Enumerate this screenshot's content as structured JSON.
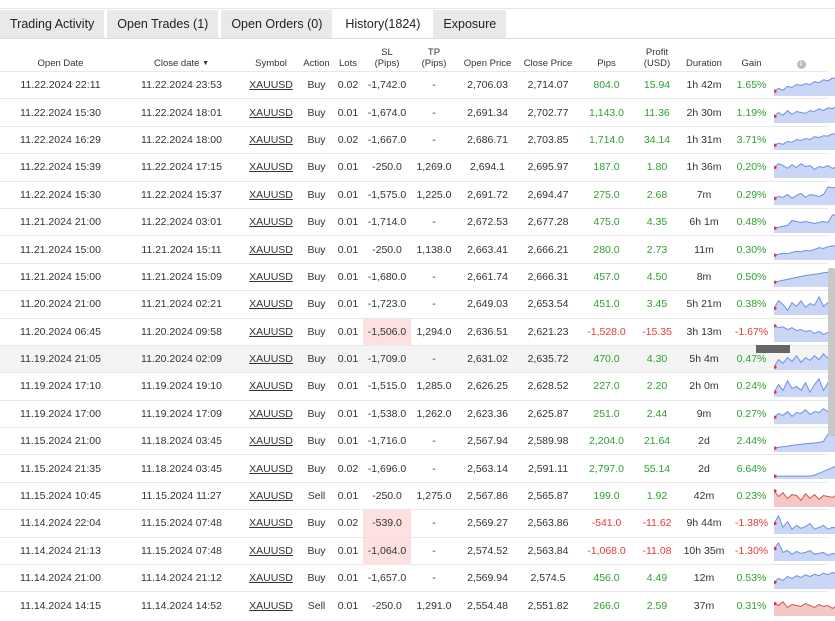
{
  "tabs": [
    {
      "label": "Trading Activity"
    },
    {
      "label": "Open Trades",
      "count": "(1)"
    },
    {
      "label": "Open Orders",
      "count": "(0)"
    },
    {
      "label": "History",
      "count": "(1824)"
    },
    {
      "label": "Exposure"
    }
  ],
  "columns": {
    "open_date": "Open Date",
    "close_date": "Close date",
    "symbol": "Symbol",
    "action": "Action",
    "lots": "Lots",
    "sl": "SL",
    "sl_unit": "(Pips)",
    "tp": "TP",
    "tp_unit": "(Pips)",
    "open_price": "Open Price",
    "close_price": "Close Price",
    "pips": "Pips",
    "profit": "Profit",
    "profit_unit": "(USD)",
    "duration": "Duration",
    "gain": "Gain",
    "info": "i"
  },
  "colors": {
    "profit": "#2ea12e",
    "loss": "#e53935",
    "sl_loss_bg": "#fde0df",
    "spark_blue": "#6f8fe6",
    "spark_red": "#d9534f"
  },
  "rows": [
    {
      "open": "11.22.2024 22:11",
      "close": "11.22.2024 23:53",
      "symbol": "XAUUSD",
      "action": "Buy",
      "lots": "0.02",
      "sl": "-1,742.0",
      "tp": "-",
      "open_price": "2,706.03",
      "close_price": "2,714.07",
      "pips": "804.0",
      "profit": "15.94",
      "duration": "1h 42m",
      "gain": "1.65%",
      "win": true,
      "sl_hit": false,
      "spark": [
        0.2,
        0.35,
        0.25,
        0.45,
        0.4,
        0.55,
        0.5,
        0.6,
        0.55,
        0.7,
        0.65,
        0.8,
        0.75,
        0.9,
        0.85,
        0.95,
        0.9
      ]
    },
    {
      "open": "11.22.2024 15:30",
      "close": "11.22.2024 18:01",
      "symbol": "XAUUSD",
      "action": "Buy",
      "lots": "0.01",
      "sl": "-1,674.0",
      "tp": "-",
      "open_price": "2,691.34",
      "close_price": "2,702.77",
      "pips": "1,143.0",
      "profit": "11.36",
      "duration": "2h 30m",
      "gain": "1.19%",
      "win": true,
      "sl_hit": false,
      "spark": [
        0.3,
        0.5,
        0.35,
        0.6,
        0.4,
        0.55,
        0.5,
        0.45,
        0.6,
        0.55,
        0.7,
        0.6,
        0.75,
        0.7,
        0.85,
        0.8,
        0.9
      ]
    },
    {
      "open": "11.22.2024 16:29",
      "close": "11.22.2024 18:00",
      "symbol": "XAUUSD",
      "action": "Buy",
      "lots": "0.02",
      "sl": "-1,667.0",
      "tp": "-",
      "open_price": "2,686.71",
      "close_price": "2,703.85",
      "pips": "1,714.0",
      "profit": "34.14",
      "duration": "1h 31m",
      "gain": "3.71%",
      "win": true,
      "sl_hit": false,
      "spark": [
        0.2,
        0.3,
        0.25,
        0.4,
        0.35,
        0.5,
        0.45,
        0.55,
        0.5,
        0.65,
        0.6,
        0.7,
        0.68,
        0.8,
        0.78,
        0.88,
        0.95
      ]
    },
    {
      "open": "11.22.2024 15:39",
      "close": "11.22.2024 17:15",
      "symbol": "XAUUSD",
      "action": "Buy",
      "lots": "0.01",
      "sl": "-250.0",
      "tp": "1,269.0",
      "open_price": "2,694.1",
      "close_price": "2,695.97",
      "pips": "187.0",
      "profit": "1.80",
      "duration": "1h 36m",
      "gain": "0.20%",
      "win": true,
      "sl_hit": false,
      "spark": [
        0.5,
        0.7,
        0.6,
        0.45,
        0.65,
        0.5,
        0.7,
        0.55,
        0.6,
        0.4,
        0.55,
        0.5,
        0.6,
        0.45,
        0.55,
        0.5,
        0.62
      ]
    },
    {
      "open": "11.22.2024 15:30",
      "close": "11.22.2024 15:37",
      "symbol": "XAUUSD",
      "action": "Buy",
      "lots": "0.01",
      "sl": "-1,575.0",
      "tp": "1,225.0",
      "open_price": "2,691.72",
      "close_price": "2,694.47",
      "pips": "275.0",
      "profit": "2.68",
      "duration": "7m",
      "gain": "0.29%",
      "win": true,
      "sl_hit": false,
      "spark": [
        0.3,
        0.4,
        0.35,
        0.5,
        0.3,
        0.45,
        0.55,
        0.35,
        0.5,
        0.45,
        0.4,
        0.5,
        0.9,
        0.85,
        0.9,
        0.9,
        0.92
      ]
    },
    {
      "open": "11.21.2024 21:00",
      "close": "11.22.2024 03:01",
      "symbol": "XAUUSD",
      "action": "Buy",
      "lots": "0.01",
      "sl": "-1,714.0",
      "tp": "-",
      "open_price": "2,672.53",
      "close_price": "2,677.28",
      "pips": "475.0",
      "profit": "4.35",
      "duration": "6h 1m",
      "gain": "0.48%",
      "win": true,
      "sl_hit": false,
      "spark": [
        0.2,
        0.25,
        0.3,
        0.35,
        0.6,
        0.55,
        0.5,
        0.55,
        0.5,
        0.45,
        0.5,
        0.55,
        0.5,
        0.9,
        0.88,
        0.86,
        0.85
      ]
    },
    {
      "open": "11.21.2024 15:00",
      "close": "11.21.2024 15:11",
      "symbol": "XAUUSD",
      "action": "Buy",
      "lots": "0.01",
      "sl": "-250.0",
      "tp": "1,138.0",
      "open_price": "2,663.41",
      "close_price": "2,666.21",
      "pips": "280.0",
      "profit": "2.73",
      "duration": "11m",
      "gain": "0.30%",
      "win": true,
      "sl_hit": false,
      "spark": [
        0.2,
        0.25,
        0.3,
        0.28,
        0.35,
        0.4,
        0.38,
        0.45,
        0.42,
        0.5,
        0.6,
        0.55,
        0.65,
        0.7,
        0.68,
        0.85,
        0.95
      ]
    },
    {
      "open": "11.21.2024 15:00",
      "close": "11.21.2024 15:09",
      "symbol": "XAUUSD",
      "action": "Buy",
      "lots": "0.01",
      "sl": "-1,680.0",
      "tp": "-",
      "open_price": "2,661.74",
      "close_price": "2,666.31",
      "pips": "457.0",
      "profit": "4.50",
      "duration": "8m",
      "gain": "0.50%",
      "win": true,
      "sl_hit": false,
      "spark": [
        0.2,
        0.25,
        0.3,
        0.35,
        0.4,
        0.45,
        0.5,
        0.55,
        0.58,
        0.62,
        0.65,
        0.7,
        0.72,
        0.78,
        0.82,
        0.88,
        0.95
      ]
    },
    {
      "open": "11.20.2024 21:00",
      "close": "11.21.2024 02:21",
      "symbol": "XAUUSD",
      "action": "Buy",
      "lots": "0.01",
      "sl": "-1,723.0",
      "tp": "-",
      "open_price": "2,649.03",
      "close_price": "2,653.54",
      "pips": "451.0",
      "profit": "3.45",
      "duration": "5h 21m",
      "gain": "0.38%",
      "win": true,
      "sl_hit": false,
      "spark": [
        0.3,
        0.7,
        0.5,
        0.2,
        0.6,
        0.4,
        0.7,
        0.35,
        0.55,
        0.45,
        0.9,
        0.4,
        0.6,
        0.3,
        0.95,
        0.5,
        0.7
      ]
    },
    {
      "open": "11.20.2024 06:45",
      "close": "11.20.2024 09:58",
      "symbol": "XAUUSD",
      "action": "Buy",
      "lots": "0.01",
      "sl": "-1,506.0",
      "tp": "1,294.0",
      "open_price": "2,636.51",
      "close_price": "2,621.23",
      "pips": "-1,528.0",
      "profit": "-15.35",
      "duration": "3h 13m",
      "gain": "-1.67%",
      "win": false,
      "sl_hit": true,
      "spark": [
        0.8,
        0.7,
        0.75,
        0.6,
        0.7,
        0.55,
        0.6,
        0.5,
        0.55,
        0.4,
        0.5,
        0.35,
        0.45,
        0.3,
        0.35,
        0.2,
        0.1
      ]
    },
    {
      "open": "11.19.2024 21:05",
      "close": "11.20.2024 02:09",
      "symbol": "XAUUSD",
      "action": "Buy",
      "lots": "0.01",
      "sl": "-1,709.0",
      "tp": "-",
      "open_price": "2,631.02",
      "close_price": "2,635.72",
      "pips": "470.0",
      "profit": "4.30",
      "duration": "5h 4m",
      "gain": "0.47%",
      "win": true,
      "sl_hit": false,
      "highlight": true,
      "spark": [
        0.1,
        0.5,
        0.3,
        0.6,
        0.4,
        0.7,
        0.35,
        0.6,
        0.45,
        0.7,
        0.5,
        0.8,
        0.55,
        0.75,
        0.6,
        0.85,
        0.9
      ]
    },
    {
      "open": "11.19.2024 17:10",
      "close": "11.19.2024 19:10",
      "symbol": "XAUUSD",
      "action": "Buy",
      "lots": "0.01",
      "sl": "-1,515.0",
      "tp": "1,285.0",
      "open_price": "2,626.25",
      "close_price": "2,628.52",
      "pips": "227.0",
      "profit": "2.20",
      "duration": "2h 0m",
      "gain": "0.24%",
      "win": true,
      "sl_hit": false,
      "spark": [
        0.2,
        0.6,
        0.3,
        0.8,
        0.4,
        0.5,
        0.3,
        0.7,
        0.2,
        0.6,
        0.9,
        0.3,
        0.7,
        0.4,
        0.85,
        0.5,
        0.95
      ]
    },
    {
      "open": "11.19.2024 17:00",
      "close": "11.19.2024 17:09",
      "symbol": "XAUUSD",
      "action": "Buy",
      "lots": "0.01",
      "sl": "-1,538.0",
      "tp": "1,262.0",
      "open_price": "2,623.36",
      "close_price": "2,625.87",
      "pips": "251.0",
      "profit": "2.44",
      "duration": "9m",
      "gain": "0.27%",
      "win": true,
      "sl_hit": false,
      "spark": [
        0.3,
        0.5,
        0.4,
        0.6,
        0.35,
        0.55,
        0.5,
        0.7,
        0.45,
        0.6,
        0.55,
        0.75,
        0.6,
        0.8,
        0.65,
        0.85,
        0.9
      ]
    },
    {
      "open": "11.15.2024 21:00",
      "close": "11.18.2024 03:45",
      "symbol": "XAUUSD",
      "action": "Buy",
      "lots": "0.01",
      "sl": "-1,716.0",
      "tp": "-",
      "open_price": "2,567.94",
      "close_price": "2,589.98",
      "pips": "2,204.0",
      "profit": "21.64",
      "duration": "2d",
      "gain": "2.44%",
      "win": true,
      "sl_hit": false,
      "spark": [
        0.15,
        0.2,
        0.22,
        0.25,
        0.3,
        0.32,
        0.35,
        0.38,
        0.4,
        0.42,
        0.45,
        0.5,
        0.9,
        0.85,
        0.82,
        0.8,
        0.78
      ]
    },
    {
      "open": "11.15.2024 21:35",
      "close": "11.18.2024 03:45",
      "symbol": "XAUUSD",
      "action": "Buy",
      "lots": "0.02",
      "sl": "-1,696.0",
      "tp": "-",
      "open_price": "2,563.14",
      "close_price": "2,591.11",
      "pips": "2,797.0",
      "profit": "55.14",
      "duration": "2d",
      "gain": "6.64%",
      "win": true,
      "sl_hit": false,
      "spark": [
        0.1,
        0.1,
        0.1,
        0.1,
        0.1,
        0.1,
        0.1,
        0.1,
        0.1,
        0.15,
        0.25,
        0.35,
        0.45,
        0.55,
        0.65,
        0.8,
        0.95
      ]
    },
    {
      "open": "11.15.2024 10:45",
      "close": "11.15.2024 11:27",
      "symbol": "XAUUSD",
      "action": "Sell",
      "lots": "0.01",
      "sl": "-250.0",
      "tp": "1,275.0",
      "open_price": "2,567.86",
      "close_price": "2,565.87",
      "pips": "199.0",
      "profit": "1.92",
      "duration": "42m",
      "gain": "0.23%",
      "win": true,
      "sl_hit": false,
      "sell": true,
      "spark": [
        0.8,
        0.5,
        0.7,
        0.4,
        0.6,
        0.55,
        0.3,
        0.65,
        0.4,
        0.6,
        0.35,
        0.55,
        0.5,
        0.45,
        0.6,
        0.4,
        0.55
      ]
    },
    {
      "open": "11.14.2024 22:04",
      "close": "11.15.2024 07:48",
      "symbol": "XAUUSD",
      "action": "Buy",
      "lots": "0.02",
      "sl": "-539.0",
      "tp": "-",
      "open_price": "2,569.27",
      "close_price": "2,563.86",
      "pips": "-541.0",
      "profit": "-11.62",
      "duration": "9h 44m",
      "gain": "-1.38%",
      "win": false,
      "sl_hit": true,
      "spark": [
        0.5,
        0.9,
        0.3,
        0.6,
        0.2,
        0.4,
        0.25,
        0.35,
        0.5,
        0.2,
        0.3,
        0.4,
        0.2,
        0.3,
        0.25,
        0.2,
        0.1
      ]
    },
    {
      "open": "11.14.2024 21:13",
      "close": "11.15.2024 07:48",
      "symbol": "XAUUSD",
      "action": "Buy",
      "lots": "0.01",
      "sl": "-1,064.0",
      "tp": "-",
      "open_price": "2,574.52",
      "close_price": "2,563.84",
      "pips": "-1,068.0",
      "profit": "-11.08",
      "duration": "10h 35m",
      "gain": "-1.30%",
      "win": false,
      "sl_hit": true,
      "spark": [
        0.6,
        0.9,
        0.4,
        0.5,
        0.3,
        0.45,
        0.35,
        0.4,
        0.5,
        0.3,
        0.35,
        0.4,
        0.25,
        0.35,
        0.3,
        0.2,
        0.1
      ]
    },
    {
      "open": "11.14.2024 21:00",
      "close": "11.14.2024 21:12",
      "symbol": "XAUUSD",
      "action": "Buy",
      "lots": "0.01",
      "sl": "-1,657.0",
      "tp": "-",
      "open_price": "2,569.94",
      "close_price": "2,574.5",
      "pips": "456.0",
      "profit": "4.49",
      "duration": "12m",
      "gain": "0.53%",
      "win": true,
      "sl_hit": false,
      "spark": [
        0.3,
        0.5,
        0.4,
        0.6,
        0.5,
        0.65,
        0.55,
        0.7,
        0.6,
        0.72,
        0.65,
        0.78,
        0.7,
        0.82,
        0.75,
        0.88,
        0.95
      ]
    },
    {
      "open": "11.14.2024 14:15",
      "close": "11.14.2024 14:52",
      "symbol": "XAUUSD",
      "action": "Sell",
      "lots": "0.01",
      "sl": "-250.0",
      "tp": "1,291.0",
      "open_price": "2,554.48",
      "close_price": "2,551.82",
      "pips": "266.0",
      "profit": "2.59",
      "duration": "37m",
      "gain": "0.31%",
      "win": true,
      "sl_hit": false,
      "sell": true,
      "spark": [
        0.6,
        0.5,
        0.7,
        0.4,
        0.55,
        0.5,
        0.45,
        0.6,
        0.5,
        0.4,
        0.55,
        0.45,
        0.5,
        0.35,
        0.5,
        0.4,
        0.3
      ]
    }
  ]
}
